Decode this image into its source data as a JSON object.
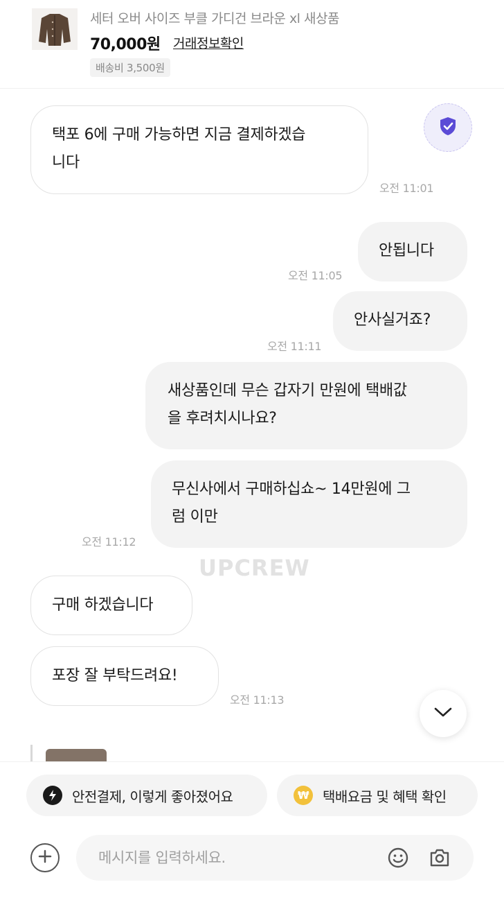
{
  "product": {
    "title": "세터 오버 사이즈 부클 가디건 브라운 xl 새상품",
    "price": "70,000원",
    "trade_link": "거래정보확인",
    "shipping": "배송비 3,500원"
  },
  "messages": [
    {
      "side": "in",
      "line1": "택포 6에 구매 가능하면 지금 결제하겠습",
      "line2": "니다",
      "time": "오전 11:01"
    },
    {
      "side": "out",
      "line1": "안됩니다",
      "time": "오전 11:05"
    },
    {
      "side": "out",
      "line1": "안사실거죠?",
      "time": "오전 11:11"
    },
    {
      "side": "out",
      "line1": "새상품인데 무슨 갑자기 만원에 택배값",
      "line2": "을 후려치시나요?"
    },
    {
      "side": "out",
      "line1": "무신사에서 구매하십쇼~ 14만원에 그",
      "line2": "럼 이만",
      "time": "오전 11:12"
    },
    {
      "side": "in",
      "line1": "구매 하겠습니다"
    },
    {
      "side": "in",
      "line1": "포장 잘 부탁드려요!",
      "time": "오전 11:13"
    }
  ],
  "watermark": "UPCREW",
  "chips": [
    {
      "label": "안전결제, 이렇게 좋아졌어요",
      "icon": "lightning-icon"
    },
    {
      "label": "택배요금 및 혜택 확인",
      "icon": "won-coin-icon",
      "icon_glyph": "₩"
    }
  ],
  "composer": {
    "placeholder": "메시지를 입력하세요."
  },
  "colors": {
    "accent_purple": "#5b4bd6",
    "coin_yellow": "#f2c13b"
  }
}
